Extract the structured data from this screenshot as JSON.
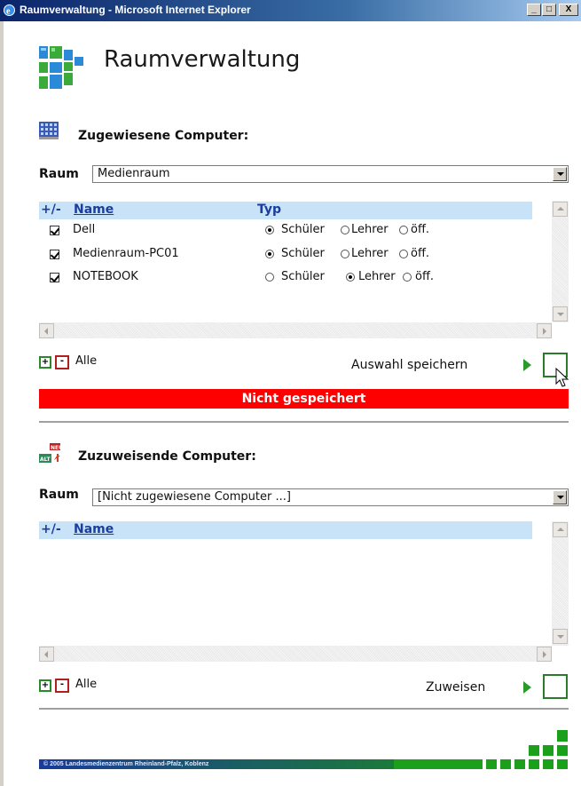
{
  "window": {
    "title": "Raumverwaltung - Microsoft Internet Explorer",
    "min": "_",
    "max": "□",
    "close": "X"
  },
  "page": {
    "title": "Raumverwaltung"
  },
  "assigned": {
    "heading": "Zugewiesene Computer:",
    "raum_label": "Raum",
    "raum_value": "Medienraum",
    "col_toggle": "+/-",
    "col_name": "Name",
    "col_type": "Typ",
    "rows": [
      {
        "name": "Dell",
        "checked": true,
        "type": "Schüler"
      },
      {
        "name": "Medienraum-PC01",
        "checked": true,
        "type": "Schüler"
      },
      {
        "name": "NOTEBOOK",
        "checked": true,
        "type": "Lehrer"
      }
    ],
    "type_options": [
      "Schüler",
      "Lehrer",
      "öff."
    ],
    "plus": "+",
    "minus": "-",
    "alle": "Alle",
    "save_label": "Auswahl speichern",
    "status": "Nicht gespeichert"
  },
  "to_assign": {
    "heading": "Zuzuweisende Computer:",
    "raum_label": "Raum",
    "raum_value": "[Nicht zugewiesene Computer ...]",
    "col_toggle": "+/-",
    "col_name": "Name",
    "plus": "+",
    "minus": "-",
    "alle": "Alle",
    "assign_label": "Zuweisen"
  },
  "footer": {
    "copyright": "© 2005 Landesmedienzentrum Rheinland-Pfalz, Koblenz"
  },
  "colors": {
    "accent_green": "#1aa01a",
    "header_blue": "#c8e2f8",
    "status_red": "#ff0000",
    "link_blue": "#1a3d9e"
  }
}
